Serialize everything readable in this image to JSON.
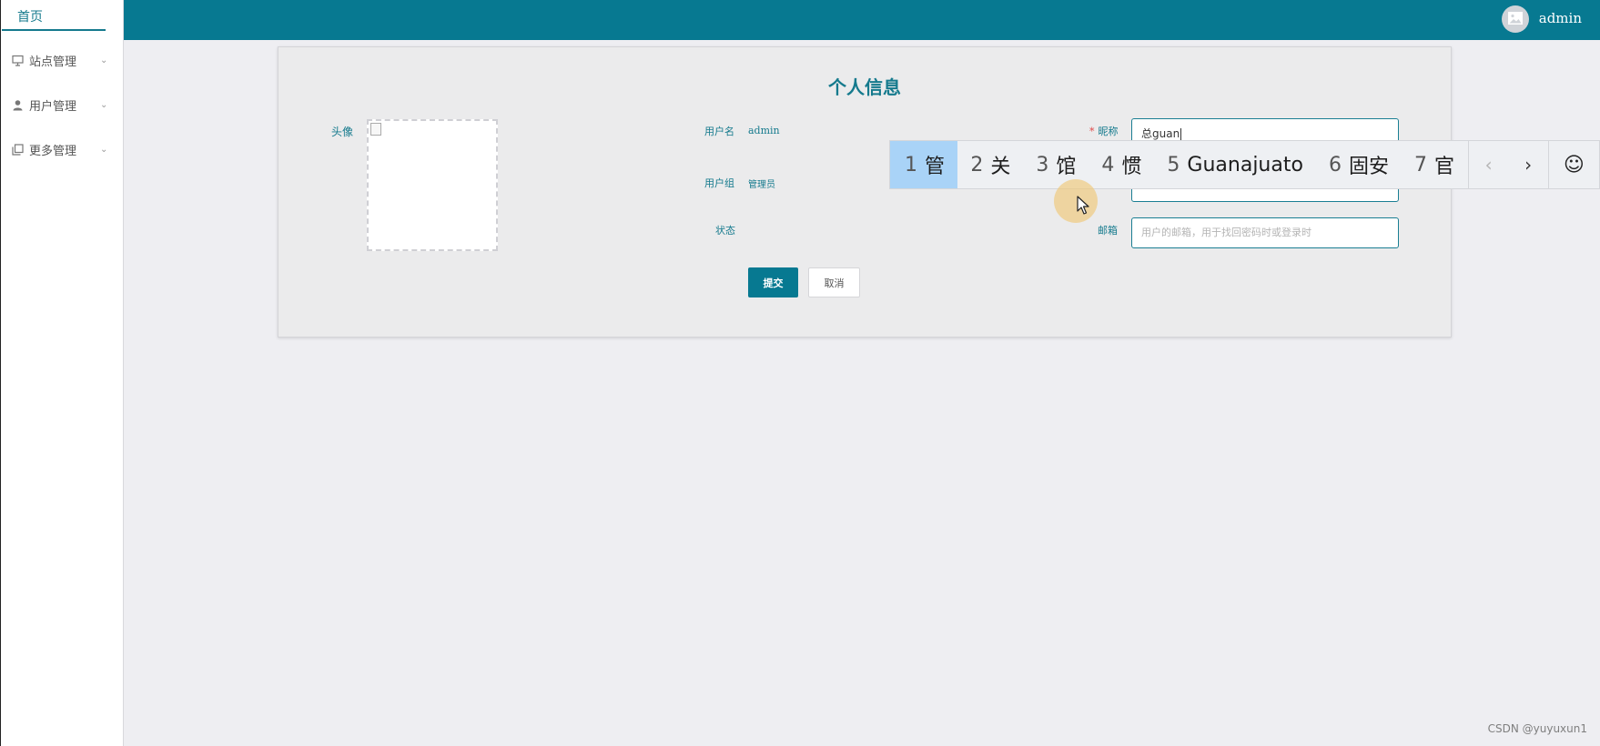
{
  "sidebar": {
    "home_label": "首页",
    "items": [
      {
        "label": "站点管理",
        "icon": "monitor-icon"
      },
      {
        "label": "用户管理",
        "icon": "user-icon"
      },
      {
        "label": "更多管理",
        "icon": "copy-icon"
      }
    ]
  },
  "header": {
    "username": "admin",
    "avatar_icon": "image-icon",
    "background": "#077991"
  },
  "profile": {
    "title": "个人信息",
    "avatar_label": "头像",
    "username_label": "用户名",
    "username_value": "admin",
    "group_label": "用户组",
    "group_value": "管理员",
    "status_label": "状态",
    "nickname_label": "昵称",
    "nickname_required_mark": "*",
    "nickname_value": "总guan",
    "email_label": "邮箱",
    "email_placeholder": "用户的邮箱，用于找回密码时或登录时",
    "submit_label": "提交",
    "cancel_label": "取消"
  },
  "ime": {
    "candidates": [
      {
        "num": "1",
        "text": "管",
        "selected": true
      },
      {
        "num": "2",
        "text": "关"
      },
      {
        "num": "3",
        "text": "馆"
      },
      {
        "num": "4",
        "text": "惯"
      },
      {
        "num": "5",
        "text": "Guanajuato"
      },
      {
        "num": "6",
        "text": "固安"
      },
      {
        "num": "7",
        "text": "官"
      }
    ],
    "prev_icon": "chevron-left-icon",
    "next_icon": "chevron-right-icon",
    "emoji_icon": "smiley-icon"
  },
  "watermark": "CSDN @yuyuxun1",
  "colors": {
    "accent": "#077991",
    "page_bg": "#eeeef2",
    "card_bg": "#ebebec",
    "ime_selected": "#a9d3f7"
  }
}
